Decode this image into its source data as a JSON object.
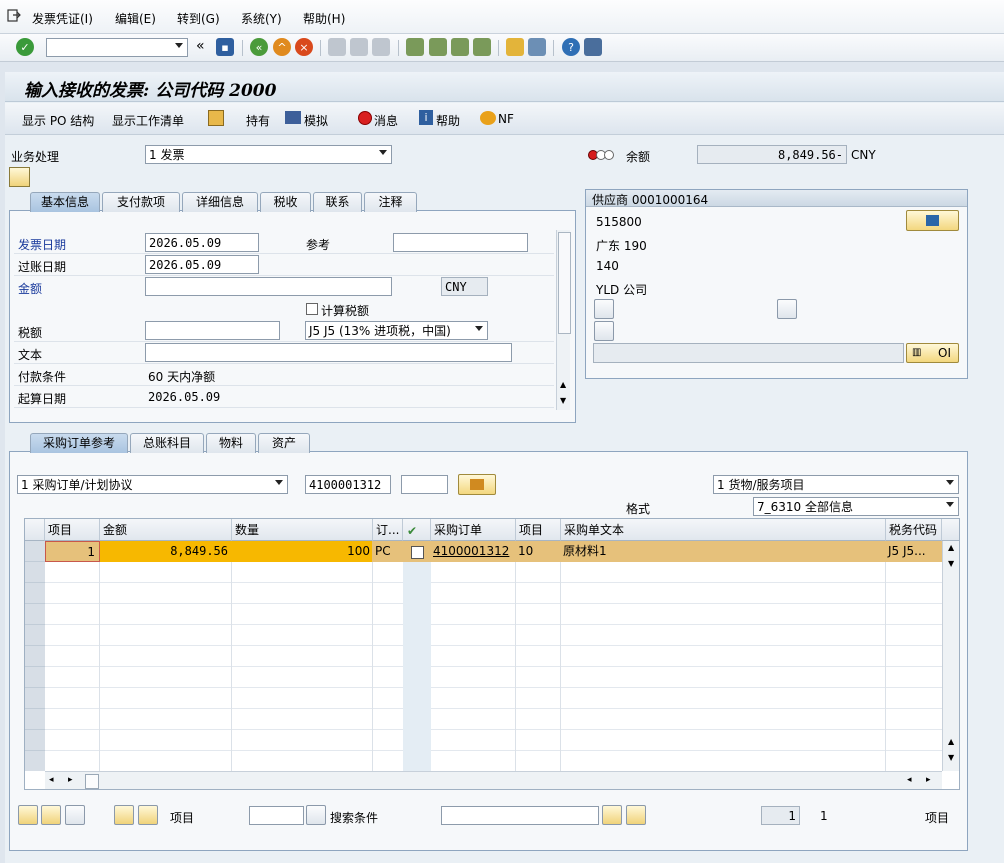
{
  "menu": {
    "items": [
      "发票凭证(I)",
      "编辑(E)",
      "转到(G)",
      "系统(Y)",
      "帮助(H)"
    ]
  },
  "toolbar": {
    "command_field": "",
    "collapse_glyph": "«"
  },
  "header": {
    "title": "输入接收的发票: 公司代码 2000"
  },
  "app_toolbar": {
    "show_po_structure": "显示 PO 结构",
    "show_worklist": "显示工作清单",
    "hold": "持有",
    "simulate": "模拟",
    "messages": "消息",
    "help": "帮助",
    "nf": "NF"
  },
  "transaction": {
    "label": "业务处理",
    "value": "1 发票"
  },
  "balance": {
    "label": "余额",
    "value": "8,849.56-",
    "currency": "CNY"
  },
  "basic_tabs": [
    "基本信息",
    "支付款项",
    "详细信息",
    "税收",
    "联系",
    "注释"
  ],
  "basic": {
    "invoice_date_label": "发票日期",
    "invoice_date": "2026.05.09",
    "reference_label": "参考",
    "reference": "",
    "posting_date_label": "过账日期",
    "posting_date": "2026.05.09",
    "amount_label": "金额",
    "amount": "",
    "amount_currency": "CNY",
    "calc_tax_label": "计算税额",
    "tax_label": "税额",
    "tax_amount": "",
    "tax_code": "J5 J5 (13% 进项税，中国)",
    "text_label": "文本",
    "text": "",
    "payment_terms_label": "付款条件",
    "payment_terms": "60 天内净额",
    "baseline_date_label": "起算日期",
    "baseline_date": "2026.05.09"
  },
  "vendor": {
    "header": "供应商 0001000164",
    "line1": "515800",
    "line2": "广东  190",
    "line3": "140",
    "line4": "YLD 公司",
    "oi_label": "OI"
  },
  "ref_tabs": [
    "采购订单参考",
    "总账科目",
    "物料",
    "资产"
  ],
  "reference": {
    "doc_type": "1 采购订单/计划协议",
    "po_number": "4100001312",
    "po_item": "",
    "item_type": "1 货物/服务项目",
    "layout_label": "格式",
    "layout": "7_6310 全部信息"
  },
  "grid": {
    "headers": [
      "项目",
      "金额",
      "数量",
      "订...",
      "",
      "采购订单",
      "项目",
      "采购单文本",
      "税务代码"
    ],
    "rows": [
      {
        "item": "1",
        "amount": "8,849.56",
        "qty": "100",
        "unit": "PC",
        "po": "4100001312",
        "po_item": "10",
        "text": "原材料1",
        "tax": "J5  J5..."
      }
    ]
  },
  "footer": {
    "item_label": "项目",
    "item_value": "",
    "search_label": "搜索条件",
    "search_value": "",
    "page_value": "1",
    "page_total": "1",
    "items_label": "项目"
  }
}
